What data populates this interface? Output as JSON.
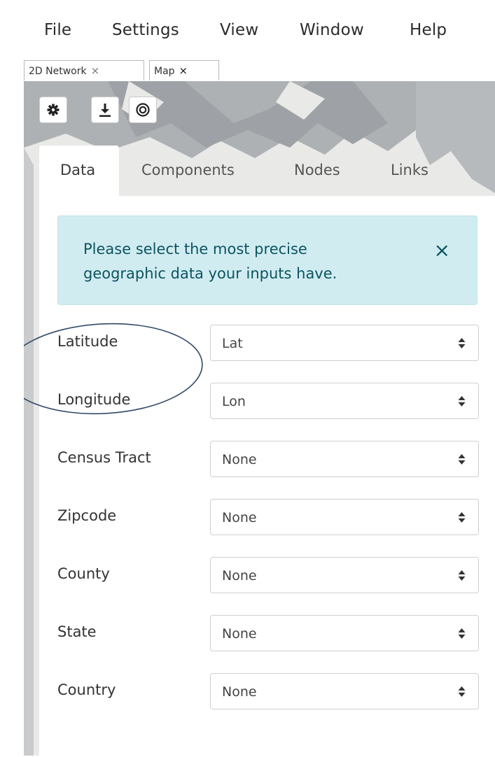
{
  "menu": [
    "File",
    "Settings",
    "View",
    "Window",
    "Help"
  ],
  "doc_tabs": [
    {
      "label": "2D Network",
      "close": "×"
    },
    {
      "label": "Map",
      "close": "×"
    }
  ],
  "toolbar": {
    "settings_icon": "gear-icon",
    "download_icon": "download-icon",
    "center_icon": "target-icon"
  },
  "panel_tabs": [
    "Data",
    "Components",
    "Nodes",
    "Links"
  ],
  "alert": {
    "text": "Please select the most precise geographic data your inputs have.",
    "close": "×",
    "colors": {
      "background": "#d1ecf1",
      "text": "#0c5460"
    }
  },
  "fields": [
    {
      "label": "Latitude",
      "value": "Lat"
    },
    {
      "label": "Longitude",
      "value": "Lon"
    },
    {
      "label": "Census Tract",
      "value": "None"
    },
    {
      "label": "Zipcode",
      "value": "None"
    },
    {
      "label": "County",
      "value": "None"
    },
    {
      "label": "State",
      "value": "None"
    },
    {
      "label": "Country",
      "value": "None"
    }
  ],
  "annotation": {
    "shape": "ellipse",
    "color": "#2f4a66",
    "encloses": [
      "Latitude",
      "Longitude"
    ]
  }
}
